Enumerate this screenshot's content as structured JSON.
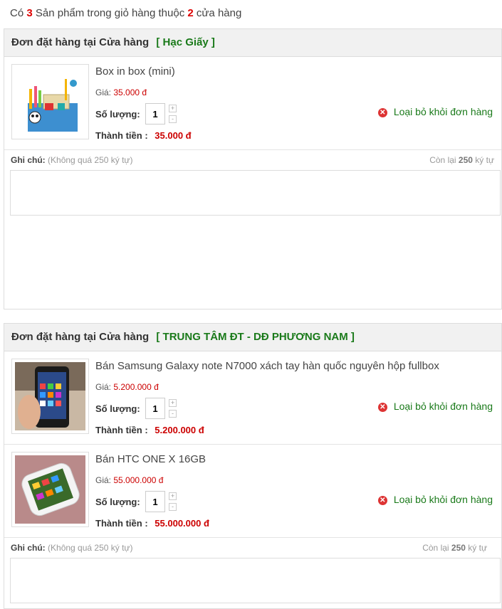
{
  "summary": {
    "prefix": "Có",
    "count": "3",
    "middle": "Sản phẩm trong giỏ hàng thuộc",
    "stores": "2",
    "suffix": "cửa hàng"
  },
  "labels": {
    "store_prefix": "Đơn đặt hàng tại Cửa hàng",
    "price": "Giá:",
    "quantity": "Số lượng:",
    "total": "Thành tiền :",
    "remove": "Loại bỏ khỏi đơn hàng",
    "note_label": "Ghi chú:",
    "note_hint": "(Không quá 250 ký tự)",
    "remaining_prefix": "Còn lại",
    "remaining_count": "250",
    "remaining_suffix": "ký tự",
    "qty_up": "+",
    "qty_down": "-"
  },
  "stores": [
    {
      "name": "[ Hạc Giấy ]",
      "items": [
        {
          "name": "Box in box (mini)",
          "price": "35.000 đ",
          "quantity": "1",
          "total": "35.000 đ",
          "image_icon": "desk-organizer-image"
        }
      ]
    },
    {
      "name": "[ TRUNG TÂM ĐT - DĐ PHƯƠNG NAM ]",
      "items": [
        {
          "name": "Bán Samsung Galaxy note N7000 xách tay hàn quốc nguyên hộp fullbox",
          "price": "5.200.000 đ",
          "quantity": "1",
          "total": "5.200.000 đ",
          "image_icon": "samsung-phone-image"
        },
        {
          "name": "Bán HTC ONE X 16GB",
          "price": "55.000.000 đ",
          "quantity": "1",
          "total": "55.000.000 đ",
          "image_icon": "htc-phone-image"
        }
      ]
    }
  ],
  "colors": {
    "accent_red": "#cc0000",
    "store_green": "#1a7a1a",
    "header_bg": "#f1f1f1"
  }
}
